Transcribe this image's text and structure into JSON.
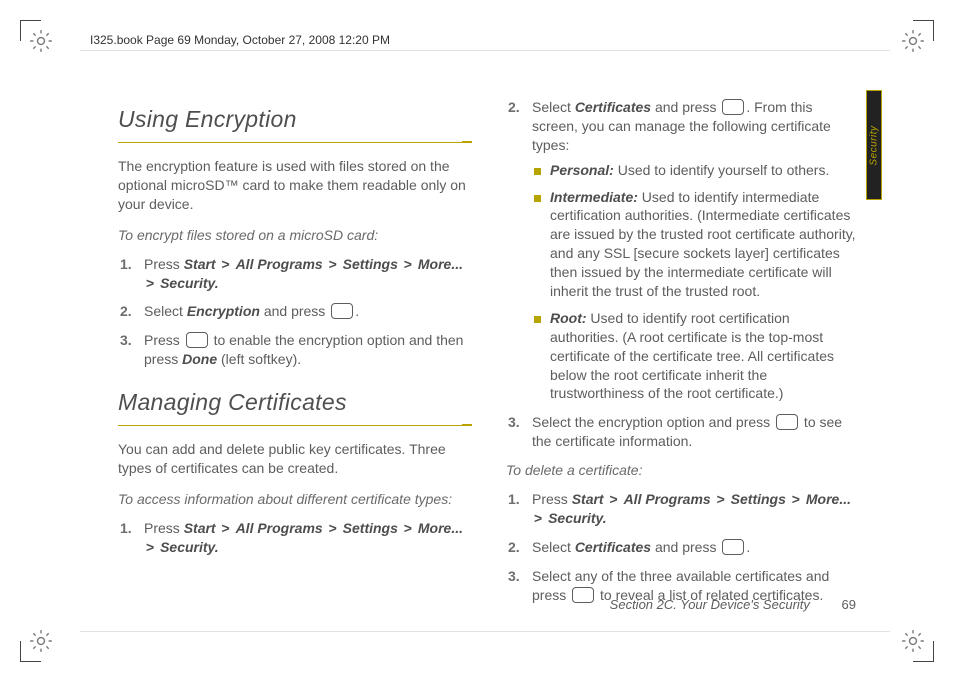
{
  "header": {
    "binder_label": "I325.book  Page 69  Monday, October 27, 2008  12:20 PM"
  },
  "sideTab": {
    "label": "Security"
  },
  "footer": {
    "section": "Section 2C. Your Device's Security",
    "page": "69"
  },
  "left": {
    "h1": "Using Encryption",
    "p1": "The encryption feature is used with files stored on the optional microSD™ card to make them readable only on your device.",
    "instr1": "To encrypt files stored on a microSD card:",
    "s1a": "Press ",
    "s1_start": "Start",
    "gt": ">",
    "s1_allprograms": "All Programs",
    "s1_settings": "Settings",
    "s1_more": "More...",
    "s1_security": "Security.",
    "s2a": "Select ",
    "s2_encryption": "Encryption",
    "s2b": " and press ",
    "dot": ".",
    "s3a": "Press ",
    "s3b": " to enable the encryption option and then press ",
    "s3_done": "Done",
    "s3c": " (left softkey).",
    "h2": "Managing Certificates",
    "p2": "You can add and delete public key certificates. Three types of certificates can be created.",
    "instr2": "To access information about different certificate types:",
    "s4a": "Press ",
    "s4_start": "Start",
    "s4_allprograms": "All Programs",
    "s4_settings": "Settings",
    "s4_more": "More...",
    "s4_security": "Security."
  },
  "right": {
    "s2a": "Select ",
    "s2_certificates": "Certificates",
    "s2b": " and press ",
    "s2c": ". From this screen, you can manage the following certificate types:",
    "b1_label": "Personal:",
    "b1_text": " Used to identify yourself to others.",
    "b2_label": "Intermediate:",
    "b2_text": " Used to identify intermediate certification authorities. (Intermediate certificates are issued by the trusted root certificate authority, and any SSL [secure sockets layer] certificates then issued by the intermediate certificate will inherit the trust of the trusted root.",
    "b3_label": "Root:",
    "b3_text": " Used to identify root certification authorities. (A root certificate is the top-most certificate of the certificate tree. All certificates below the root certificate inherit the trustworthiness of the root certificate.)",
    "s3a": "Select the encryption option and press ",
    "s3b": " to see the certificate information.",
    "instr3": "To delete a certificate:",
    "d1a": "Press ",
    "d1_start": "Start",
    "d1_allprograms": "All Programs",
    "d1_settings": "Settings",
    "d1_more": "More...",
    "d1_security": "Security.",
    "d2a": "Select ",
    "d2_certificates": "Certificates",
    "d2b": " and press ",
    "dot": ".",
    "d3a": "Select any of the three available certificates and press ",
    "d3b": " to reveal a list of related certificates."
  }
}
